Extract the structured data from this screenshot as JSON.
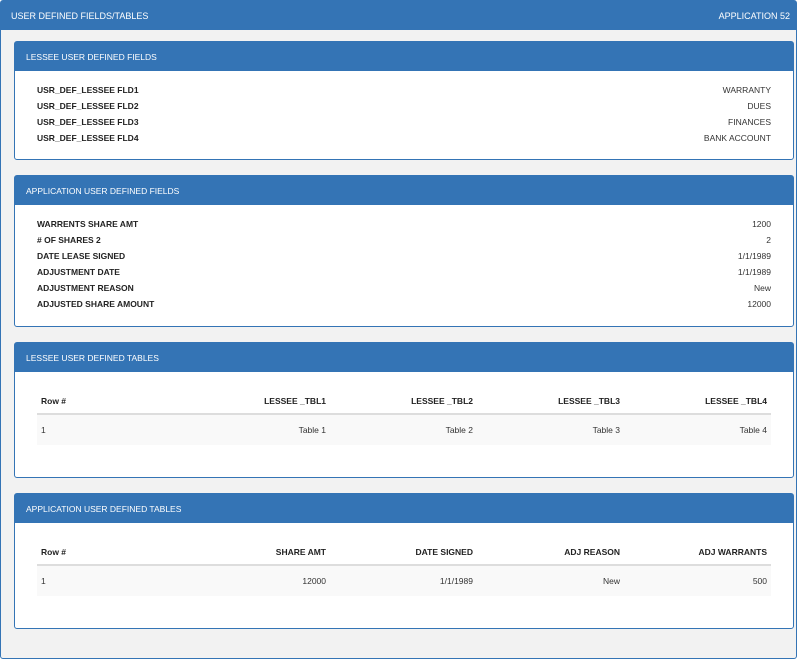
{
  "header": {
    "title": "USER DEFINED FIELDS/TABLES",
    "application": "APPLICATION 52"
  },
  "lessee_fields": {
    "title": "LESSEE USER DEFINED FIELDS",
    "rows": [
      {
        "key": "USR_DEF_LESSEE FLD1",
        "value": "WARRANTY"
      },
      {
        "key": "USR_DEF_LESSEE FLD2",
        "value": "DUES"
      },
      {
        "key": "USR_DEF_LESSEE FLD3",
        "value": "FINANCES"
      },
      {
        "key": "USR_DEF_LESSEE FLD4",
        "value": "BANK ACCOUNT"
      }
    ]
  },
  "application_fields": {
    "title": "APPLICATION USER DEFINED FIELDS",
    "rows": [
      {
        "key": "WARRENTS SHARE AMT",
        "value": "1200"
      },
      {
        "key": "# OF SHARES 2",
        "value": "2"
      },
      {
        "key": "DATE LEASE SIGNED",
        "value": "1/1/1989"
      },
      {
        "key": "ADJUSTMENT DATE",
        "value": "1/1/1989"
      },
      {
        "key": "ADJUSTMENT REASON",
        "value": "New"
      },
      {
        "key": "ADJUSTED SHARE AMOUNT",
        "value": "12000"
      }
    ]
  },
  "lessee_tables": {
    "title": "LESSEE USER DEFINED TABLES",
    "columns": [
      "Row #",
      "LESSEE _TBL1",
      "LESSEE _TBL2",
      "LESSEE _TBL3",
      "LESSEE _TBL4"
    ],
    "rows": [
      [
        "1",
        "Table 1",
        "Table 2",
        "Table 3",
        "Table 4"
      ]
    ]
  },
  "application_tables": {
    "title": "APPLICATION USER DEFINED TABLES",
    "columns": [
      "Row #",
      "SHARE AMT",
      "DATE SIGNED",
      "ADJ REASON",
      "ADJ WARRANTS"
    ],
    "rows": [
      [
        "1",
        "12000",
        "1/1/1989",
        "New",
        "500"
      ]
    ]
  }
}
